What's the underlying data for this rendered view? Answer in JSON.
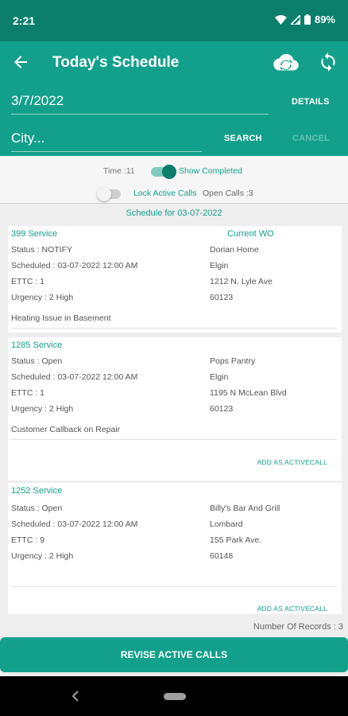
{
  "status_bar": {
    "time": "2:21",
    "battery": "89%"
  },
  "app_bar": {
    "title": "Today's Schedule",
    "icons": [
      "back-arrow-icon",
      "cloud-sync-icon",
      "refresh-icon"
    ]
  },
  "header": {
    "date_value": "3/7/2022",
    "details_label": "DETAILS",
    "city_placeholder": "City...",
    "search_label": "SEARCH",
    "cancel_label": "CANCEL"
  },
  "controls": {
    "time_text": "Time :11",
    "show_completed_label": "Show Completed",
    "show_completed_on": true,
    "lock_active_label": "Lock Active Calls",
    "lock_active_on": false,
    "open_calls_text": "Open Calls :3"
  },
  "schedule_label": "Schedule for 03-07-2022",
  "calls": [
    {
      "number": "399  Service",
      "badge": "Current WO",
      "status": "Status :  NOTIFY",
      "scheduled": "Scheduled : 03-07-2022 12:00 AM",
      "ettc": "ETTC :  1",
      "urgency": "Urgency :  2 High",
      "name": "Dorian Home",
      "city": "Elgin",
      "address": "1212 N. Lyle Ave",
      "zip": "60123",
      "description": "Heating Issue in Basement",
      "action": ""
    },
    {
      "number": "1285  Service",
      "badge": "",
      "status": "Status :  Open",
      "scheduled": "Scheduled : 03-07-2022 12:00 AM",
      "ettc": "ETTC :  1",
      "urgency": "Urgency :  2 High",
      "name": "Pops Pantry",
      "city": "Elgin",
      "address": "1195 N McLean Blvd",
      "zip": "60123",
      "description": "Customer Callback on Repair",
      "action": "ADD AS ACTIVECALL"
    },
    {
      "number": "1252  Service",
      "badge": "",
      "status": "Status :  Open",
      "scheduled": "Scheduled : 03-07-2022 12:00 AM",
      "ettc": "ETTC :  9",
      "urgency": "Urgency :  2 High",
      "name": "Billy's Bar And Grill",
      "city": "Lombard",
      "address": "155 Park Ave.",
      "zip": "60148",
      "description": "",
      "action": "ADD AS ACTIVECALL"
    }
  ],
  "records_text": "Number Of Records : 3",
  "revise_label": "REVISE ACTIVE CALLS",
  "colors": {
    "primary": "#13a08b",
    "primary_dark": "#0b7e6c"
  }
}
